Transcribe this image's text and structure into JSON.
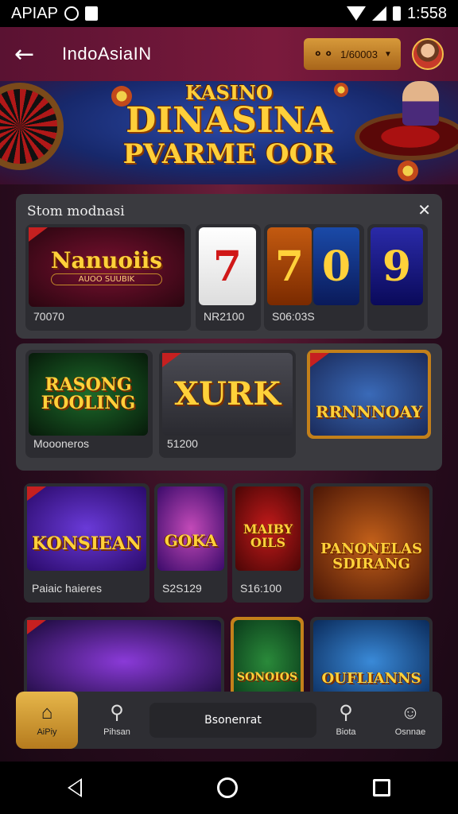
{
  "status_bar": {
    "left_text": "APIAP",
    "time": "1:558"
  },
  "app_bar": {
    "title": "IndoAsiaIN",
    "balance": "1/60003",
    "back_icon": "back-arrow-icon"
  },
  "banner": {
    "line1": "KASINO",
    "line2": "DINASINA",
    "line3": "PVARME OOR"
  },
  "panel": {
    "title": "Stom modnasi"
  },
  "games_row1": [
    {
      "title": "Nanuoiis",
      "subtitle": "AUOO SUUBIK",
      "caption": "70070"
    },
    {
      "caption": "NR2100"
    },
    {
      "caption": "S06:03S"
    }
  ],
  "slot_reels": [
    "7",
    "7",
    "0",
    "9"
  ],
  "games_row2": [
    {
      "title": "RASONG\nFOOLING",
      "caption": "Moooneros"
    },
    {
      "title": "XURK",
      "caption": "51200"
    },
    {
      "title": "RRNNNOAY",
      "caption": ""
    }
  ],
  "games_row3": [
    {
      "title": "KONSIEAN",
      "caption": "Paiaic haieres"
    },
    {
      "title": "GOKA",
      "caption": "S2S129"
    },
    {
      "title": "MAIBY OILS",
      "caption": "S16:100"
    },
    {
      "title": "PANONELAS SDIRANG",
      "caption": ""
    }
  ],
  "games_row4": [
    {
      "title": ""
    },
    {
      "title": "SONOIOS"
    },
    {
      "title": "OUFLIANNS"
    }
  ],
  "bottom_nav": {
    "home": "AiPiy",
    "search_left": "Pihsan",
    "center": "Bsonenrat",
    "right1": "Biota",
    "right2": "Osnnae"
  },
  "colors": {
    "accent_gold": "#e6b64a",
    "appbar": "#6a1636",
    "panel": "#3a3a3f"
  }
}
